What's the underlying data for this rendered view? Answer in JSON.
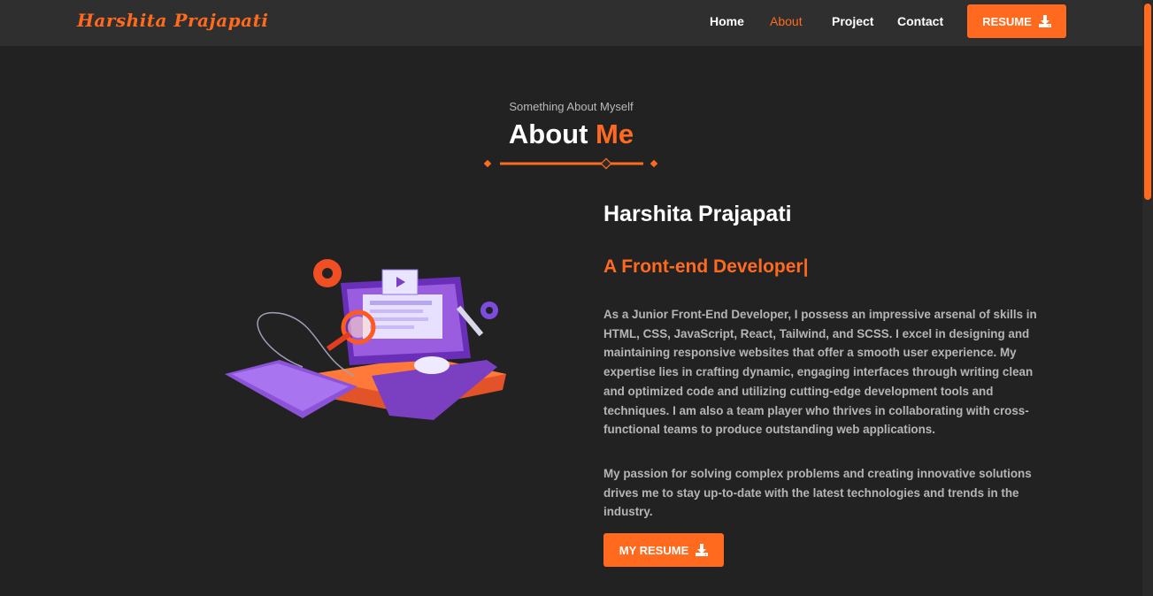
{
  "header": {
    "brand": "Harshita Prajapati",
    "nav": [
      "Home",
      "About",
      "Project",
      "Contact"
    ],
    "active_nav": "About",
    "resume_button": "RESUME"
  },
  "about": {
    "subtitle": "Something About Myself",
    "title_main": "About",
    "title_accent": "Me",
    "name": "Harshita Prajapati",
    "role": "A Front-end Developer|",
    "paragraph1": "As a Junior Front-End Developer, I possess an impressive arsenal of skills in HTML, CSS, JavaScript, React, Tailwind, and SCSS. I excel in designing and maintaining responsive websites that offer a smooth user experience. My expertise lies in crafting dynamic, engaging interfaces through writing clean and optimized code and utilizing cutting-edge development tools and techniques. I am also a team player who thrives in collaborating with cross-functional teams to produce outstanding web applications.",
    "paragraph2": "My passion for solving complex problems and creating innovative solutions drives me to stay up-to-date with the latest technologies and trends in the industry.",
    "resume_button": "MY RESUME"
  },
  "icons": {
    "download": "download-icon",
    "illustration": "developer-workstation-illustration"
  },
  "colors": {
    "accent": "#ff6a1f",
    "background": "#222222",
    "header": "#2f2f2f",
    "text": "#ffffff",
    "muted_text": "#b5b5b5"
  }
}
